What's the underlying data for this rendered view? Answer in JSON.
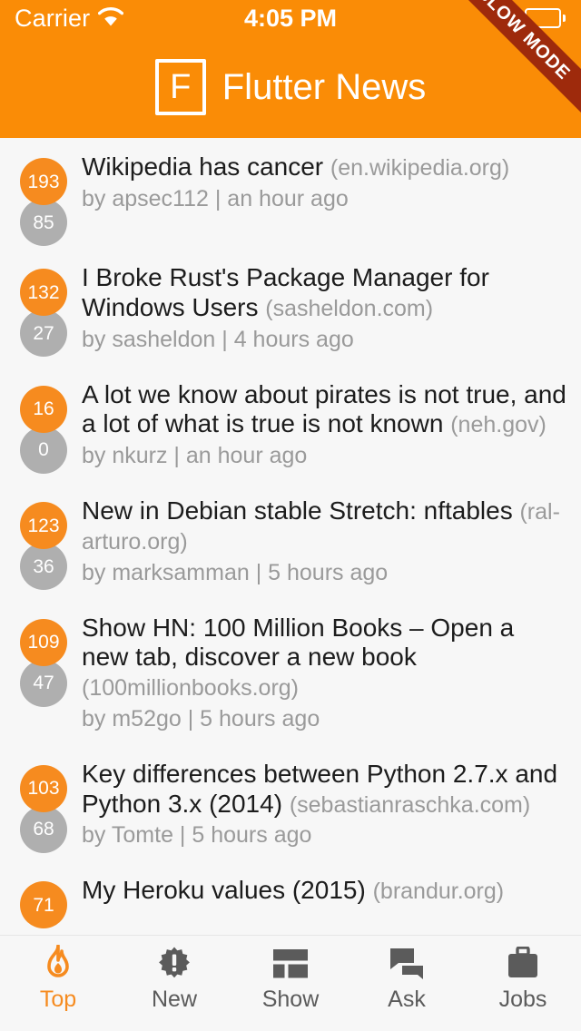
{
  "status_bar": {
    "carrier": "Carrier",
    "time": "4:05 PM",
    "wifi_icon": "wifi-icon",
    "battery_icon": "battery-icon"
  },
  "ribbon": {
    "label": "SLOW MODE",
    "color": "#9E2A0C"
  },
  "appbar": {
    "logo_letter": "F",
    "title": "Flutter News",
    "background_color": "#FA8C06"
  },
  "colors": {
    "accent": "#F68B1F",
    "score_badge": "#F68B1F",
    "comment_badge": "#AFAFAF",
    "list_background": "#f7f7f7",
    "headline": "#1c1c1c",
    "muted": "#9a9a9a"
  },
  "stories": [
    {
      "score": "193",
      "comments": "85",
      "title": "Wikipedia has cancer",
      "domain": "(en.wikipedia.org)",
      "meta": "by apsec112 | an hour ago"
    },
    {
      "score": "132",
      "comments": "27",
      "title": "I Broke Rust's Package Manager for Windows Users",
      "domain": "(sasheldon.com)",
      "meta": "by sasheldon | 4 hours ago"
    },
    {
      "score": "16",
      "comments": "0",
      "title": "A lot we know about pirates is not true, and a lot of what is true is not known",
      "domain": "(neh.gov)",
      "meta": "by nkurz | an hour ago"
    },
    {
      "score": "123",
      "comments": "36",
      "title": "New in Debian stable Stretch: nftables",
      "domain": "(ral-arturo.org)",
      "meta": "by marksamman | 5 hours ago"
    },
    {
      "score": "109",
      "comments": "47",
      "title": "Show HN: 100 Million Books – Open a new tab, discover a new book",
      "domain": "(100millionbooks.org)",
      "meta": "by m52go | 5 hours ago"
    },
    {
      "score": "103",
      "comments": "68",
      "title": "Key differences between Python 2.7.x and Python 3.x (2014)",
      "domain": "(sebastianraschka.com)",
      "meta": "by Tomte | 5 hours ago"
    },
    {
      "score": "71",
      "comments": "",
      "title": "My Heroku values (2015)",
      "domain": "(brandur.org)",
      "meta": ""
    }
  ],
  "bottom_nav": {
    "items": [
      {
        "label": "Top",
        "icon": "flame-icon",
        "active": true
      },
      {
        "label": "New",
        "icon": "starburst-exclamation-icon",
        "active": false
      },
      {
        "label": "Show",
        "icon": "dashboard-icon",
        "active": false
      },
      {
        "label": "Ask",
        "icon": "chat-bubbles-icon",
        "active": false
      },
      {
        "label": "Jobs",
        "icon": "briefcase-icon",
        "active": false
      }
    ]
  }
}
